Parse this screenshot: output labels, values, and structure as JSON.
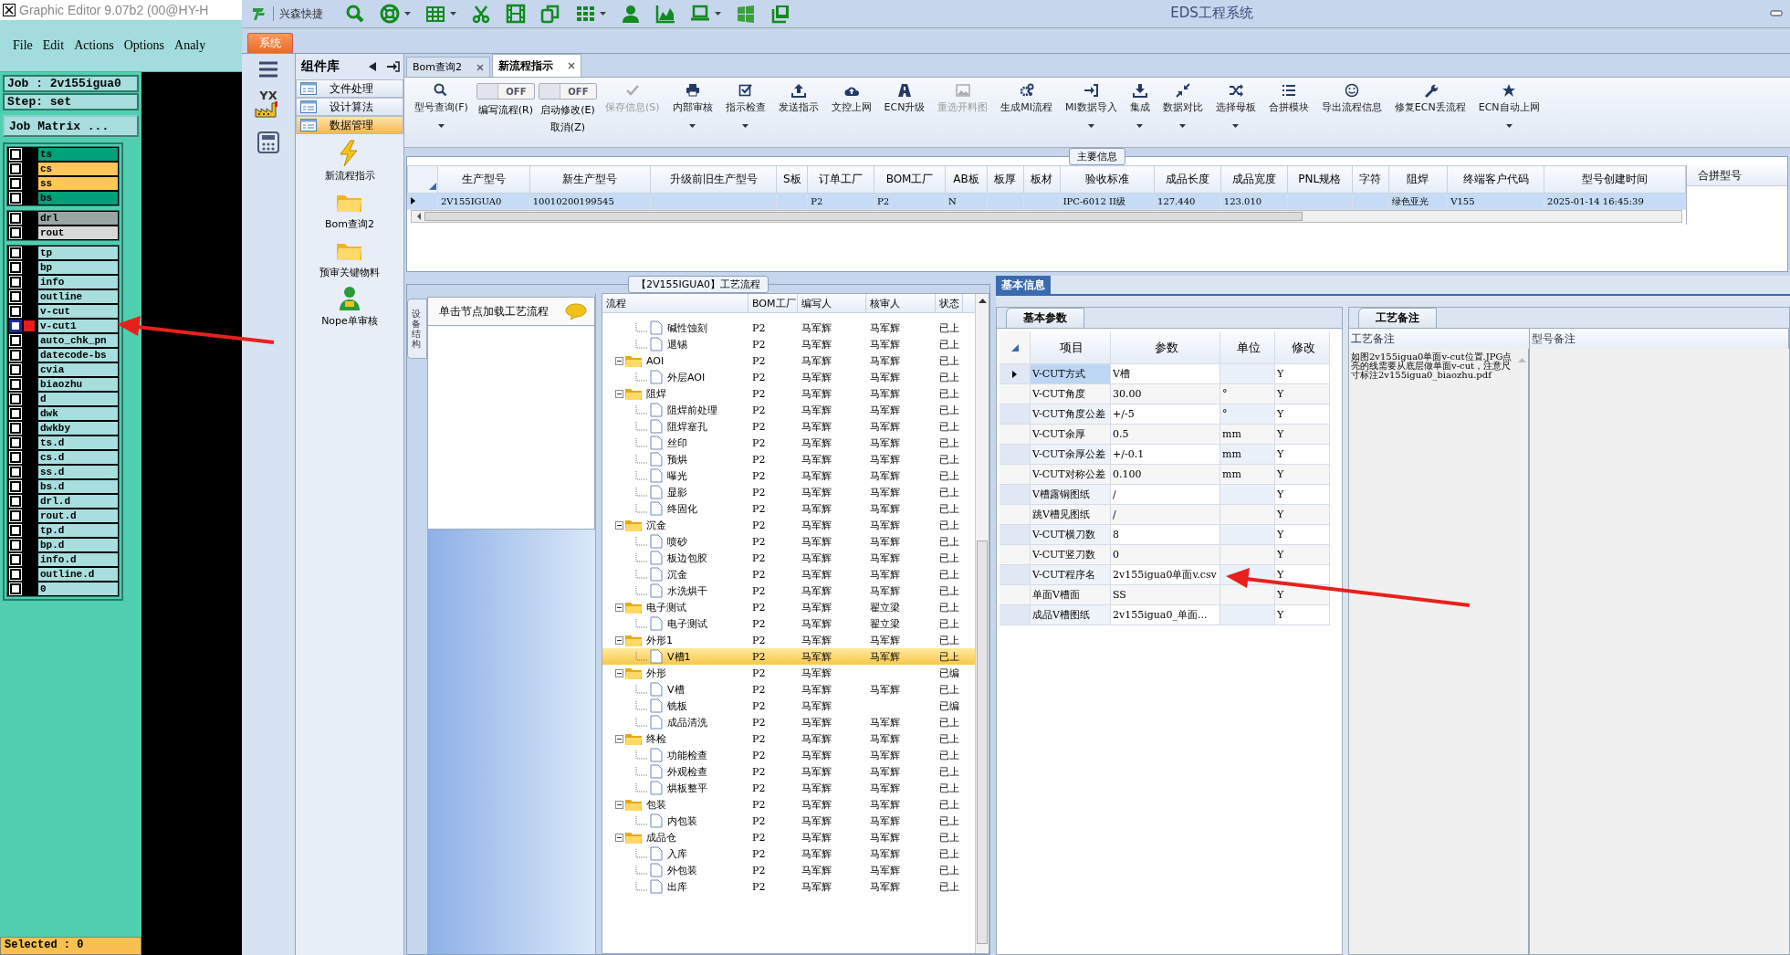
{
  "graphic_editor": {
    "title": "Graphic Editor 9.07b2 (00@HY-H",
    "menu": [
      "File",
      "Edit",
      "Actions",
      "Options",
      "Analy"
    ],
    "job": "Job : 2v155igua0",
    "step": "Step: set",
    "job_matrix_button": "Job Matrix ...",
    "layer_groups": [
      {
        "layers": [
          {
            "name": "ts",
            "color": "#00a078",
            "work_layer": false,
            "checked": false
          },
          {
            "name": "cs",
            "color": "#ffc65a",
            "work_layer": false,
            "checked": false
          },
          {
            "name": "ss",
            "color": "#ffc65a",
            "work_layer": false,
            "checked": false
          },
          {
            "name": "bs",
            "color": "#00a078",
            "work_layer": false,
            "checked": false
          }
        ]
      },
      {
        "layers": [
          {
            "name": "drl",
            "color": "#9aa6a6",
            "work_layer": false,
            "checked": false
          },
          {
            "name": "rout",
            "color": "#d8d8d8",
            "work_layer": false,
            "checked": false
          }
        ]
      },
      {
        "layers": [
          {
            "name": "tp",
            "color": "#a8dede",
            "work_layer": false,
            "checked": false
          },
          {
            "name": "bp",
            "color": "#a8dede",
            "work_layer": false,
            "checked": false
          },
          {
            "name": "info",
            "color": "#a8dede",
            "work_layer": false,
            "checked": false
          },
          {
            "name": "outline",
            "color": "#a8dede",
            "work_layer": false,
            "checked": false
          },
          {
            "name": "v-cut",
            "color": "#a8dede",
            "work_layer": false,
            "checked": false
          },
          {
            "name": "v-cut1",
            "color": "#a8dede",
            "work_layer": true,
            "checked": false
          },
          {
            "name": "auto_chk_pn",
            "color": "#a8dede",
            "work_layer": false,
            "checked": false
          },
          {
            "name": "datecode-bs",
            "color": "#a8dede",
            "work_layer": false,
            "checked": false
          },
          {
            "name": "cvia",
            "color": "#a8dede",
            "work_layer": false,
            "checked": false
          },
          {
            "name": "biaozhu",
            "color": "#a8dede",
            "work_layer": false,
            "checked": false
          },
          {
            "name": "d",
            "color": "#a8dede",
            "work_layer": false,
            "checked": false
          },
          {
            "name": "dwk",
            "color": "#a8dede",
            "work_layer": false,
            "checked": false
          },
          {
            "name": "dwkby",
            "color": "#a8dede",
            "work_layer": false,
            "checked": false
          },
          {
            "name": "ts.d",
            "color": "#a8dede",
            "work_layer": false,
            "checked": false
          },
          {
            "name": "cs.d",
            "color": "#a8dede",
            "work_layer": false,
            "checked": false
          },
          {
            "name": "ss.d",
            "color": "#a8dede",
            "work_layer": false,
            "checked": false
          },
          {
            "name": "bs.d",
            "color": "#a8dede",
            "work_layer": false,
            "checked": false
          },
          {
            "name": "drl.d",
            "color": "#a8dede",
            "work_layer": false,
            "checked": false
          },
          {
            "name": "rout.d",
            "color": "#a8dede",
            "work_layer": false,
            "checked": false
          },
          {
            "name": "tp.d",
            "color": "#a8dede",
            "work_layer": false,
            "checked": false
          },
          {
            "name": "bp.d",
            "color": "#a8dede",
            "work_layer": false,
            "checked": false
          },
          {
            "name": "info.d",
            "color": "#a8dede",
            "work_layer": false,
            "checked": false
          },
          {
            "name": "outline.d",
            "color": "#a8dede",
            "work_layer": false,
            "checked": false
          },
          {
            "name": "0",
            "color": "#a8dede",
            "work_layer": false,
            "checked": false
          }
        ]
      }
    ],
    "selected_status": "Selected : 0"
  },
  "eds": {
    "app_name": "兴森快捷",
    "title": "EDS工程系统",
    "menu_tab": "系统",
    "nav_logo": "YX",
    "component_library": {
      "title": "组件库",
      "categories": [
        {
          "label": "文件处理",
          "selected": false
        },
        {
          "label": "设计算法",
          "selected": false
        },
        {
          "label": "数据管理",
          "selected": true
        }
      ],
      "items": [
        "新流程指示",
        "Bom查询2",
        "预审关键物料",
        "Nope单审核"
      ]
    },
    "document_tabs": [
      {
        "label": "Bom查询2",
        "selected": false
      },
      {
        "label": "新流程指示",
        "selected": true
      }
    ],
    "toolbar": [
      {
        "kind": "button",
        "label": "型号查询(F)",
        "dropdown": true,
        "disabled": false
      },
      {
        "kind": "toggle",
        "state_text": "OFF",
        "on": false,
        "label": "编写流程(R)"
      },
      {
        "kind": "toggle",
        "state_text": "OFF",
        "on": false,
        "label": "启动修改(E)",
        "second_label": "取消(Z)"
      },
      {
        "kind": "button",
        "label": "保存信息(S)",
        "dropdown": false,
        "disabled": true
      },
      {
        "kind": "button",
        "label": "内部审核",
        "dropdown": true,
        "disabled": false
      },
      {
        "kind": "button",
        "label": "指示检查",
        "dropdown": true,
        "disabled": false
      },
      {
        "kind": "button",
        "label": "发送指示",
        "dropdown": false,
        "disabled": false
      },
      {
        "kind": "button",
        "label": "文控上网",
        "dropdown": false,
        "disabled": false
      },
      {
        "kind": "button",
        "label": "ECN升级",
        "dropdown": false,
        "disabled": false
      },
      {
        "kind": "button",
        "label": "重选开料图",
        "dropdown": false,
        "disabled": true
      },
      {
        "kind": "button",
        "label": "生成MI流程",
        "dropdown": false,
        "disabled": false
      },
      {
        "kind": "button",
        "label": "MI数据导入",
        "dropdown": true,
        "disabled": false
      },
      {
        "kind": "button",
        "label": "集成",
        "dropdown": true,
        "disabled": false
      },
      {
        "kind": "button",
        "label": "数据对比",
        "dropdown": true,
        "disabled": false
      },
      {
        "kind": "button",
        "label": "选择母板",
        "dropdown": true,
        "disabled": false
      },
      {
        "kind": "button",
        "label": "合拼模块",
        "dropdown": false,
        "disabled": false
      },
      {
        "kind": "button",
        "label": "导出流程信息",
        "dropdown": false,
        "disabled": false
      },
      {
        "kind": "button",
        "label": "修复ECN丢流程",
        "dropdown": false,
        "disabled": false
      },
      {
        "kind": "button",
        "label": "ECN自动上网",
        "dropdown": true,
        "disabled": false
      }
    ],
    "main_info": {
      "title": "主要信息",
      "columns": [
        "生产型号",
        "新生产型号",
        "升级前旧生产型号",
        "S板",
        "订单工厂",
        "BOM工厂",
        "AB板",
        "板厚",
        "板材",
        "验收标准",
        "成品长度",
        "成品宽度",
        "PNL规格",
        "字符",
        "阻焊",
        "终端客户代码",
        "型号创建时间"
      ],
      "rows": [
        {
          "selected": true,
          "cells": [
            "2V155IGUA0",
            "10010200199545",
            null,
            null,
            "P2",
            "P2",
            "N",
            null,
            null,
            "IPC-6012 II级",
            "127.440",
            "123.010",
            null,
            null,
            "绿色亚光",
            "V155",
            "2025-01-14 16:45:39"
          ]
        }
      ],
      "side_column": "合拼型号"
    },
    "process_flow": {
      "title": "【2V155IGUA0】工艺流程",
      "side_tab": "设备结构",
      "hint": "单击节点加载工艺流程",
      "columns": [
        "流程",
        "BOM工厂",
        "编写人",
        "核审人",
        "状态"
      ],
      "nodes": [
        {
          "kind": "offscreen",
          "children": [
            {
              "kind": "step",
              "label": "碱性蚀刻",
              "bom": "P2",
              "writer": "马军辉",
              "reviewer": "马军辉",
              "status": "已上",
              "selected": false
            },
            {
              "kind": "step",
              "label": "退锡",
              "bom": "P2",
              "writer": "马军辉",
              "reviewer": "马军辉",
              "status": "已上",
              "selected": false
            }
          ]
        },
        {
          "kind": "folder",
          "label": "AOI",
          "expanded": true,
          "bom": "P2",
          "writer": "马军辉",
          "reviewer": "马军辉",
          "status": "已上",
          "selected": false,
          "children": [
            {
              "kind": "step",
              "label": "外层AOI",
              "bom": "P2",
              "writer": "马军辉",
              "reviewer": "马军辉",
              "status": "已上",
              "selected": false
            }
          ]
        },
        {
          "kind": "folder",
          "label": "阻焊",
          "expanded": true,
          "bom": "P2",
          "writer": "马军辉",
          "reviewer": "马军辉",
          "status": "已上",
          "selected": false,
          "children": [
            {
              "kind": "step",
              "label": "阻焊前处理",
              "bom": "P2",
              "writer": "马军辉",
              "reviewer": "马军辉",
              "status": "已上",
              "selected": false
            },
            {
              "kind": "step",
              "label": "阻焊塞孔",
              "bom": "P2",
              "writer": "马军辉",
              "reviewer": "马军辉",
              "status": "已上",
              "selected": false
            },
            {
              "kind": "step",
              "label": "丝印",
              "bom": "P2",
              "writer": "马军辉",
              "reviewer": "马军辉",
              "status": "已上",
              "selected": false
            },
            {
              "kind": "step",
              "label": "预烘",
              "bom": "P2",
              "writer": "马军辉",
              "reviewer": "马军辉",
              "status": "已上",
              "selected": false
            },
            {
              "kind": "step",
              "label": "曝光",
              "bom": "P2",
              "writer": "马军辉",
              "reviewer": "马军辉",
              "status": "已上",
              "selected": false
            },
            {
              "kind": "step",
              "label": "显影",
              "bom": "P2",
              "writer": "马军辉",
              "reviewer": "马军辉",
              "status": "已上",
              "selected": false
            },
            {
              "kind": "step",
              "label": "终固化",
              "bom": "P2",
              "writer": "马军辉",
              "reviewer": "马军辉",
              "status": "已上",
              "selected": false
            }
          ]
        },
        {
          "kind": "folder",
          "label": "沉金",
          "expanded": true,
          "bom": "P2",
          "writer": "马军辉",
          "reviewer": "马军辉",
          "status": "已上",
          "selected": false,
          "children": [
            {
              "kind": "step",
              "label": "喷砂",
              "bom": "P2",
              "writer": "马军辉",
              "reviewer": "马军辉",
              "status": "已上",
              "selected": false
            },
            {
              "kind": "step",
              "label": "板边包胶",
              "bom": "P2",
              "writer": "马军辉",
              "reviewer": "马军辉",
              "status": "已上",
              "selected": false
            },
            {
              "kind": "step",
              "label": "沉金",
              "bom": "P2",
              "writer": "马军辉",
              "reviewer": "马军辉",
              "status": "已上",
              "selected": false
            },
            {
              "kind": "step",
              "label": "水洗烘干",
              "bom": "P2",
              "writer": "马军辉",
              "reviewer": "马军辉",
              "status": "已上",
              "selected": false
            }
          ]
        },
        {
          "kind": "folder",
          "label": "电子测试",
          "expanded": true,
          "bom": "P2",
          "writer": "马军辉",
          "reviewer": "翟立梁",
          "status": "已上",
          "selected": false,
          "children": [
            {
              "kind": "step",
              "label": "电子测试",
              "bom": "P2",
              "writer": "马军辉",
              "reviewer": "翟立梁",
              "status": "已上",
              "selected": false
            }
          ]
        },
        {
          "kind": "folder",
          "label": "外形1",
          "expanded": true,
          "bom": "P2",
          "writer": "马军辉",
          "reviewer": "马军辉",
          "status": "已上",
          "selected": false,
          "children": [
            {
              "kind": "step",
              "label": "V槽1",
              "bom": "P2",
              "writer": "马军辉",
              "reviewer": "马军辉",
              "status": "已上",
              "selected": true
            }
          ]
        },
        {
          "kind": "folder",
          "label": "外形",
          "expanded": true,
          "bom": "P2",
          "writer": "马军辉",
          "status": "已编",
          "selected": false,
          "children": [
            {
              "kind": "step",
              "label": "V槽",
              "bom": "P2",
              "writer": "马军辉",
              "reviewer": "马军辉",
              "status": "已上",
              "selected": false
            },
            {
              "kind": "step",
              "label": "铣板",
              "bom": "P2",
              "writer": "马军辉",
              "status": "已编",
              "selected": false
            },
            {
              "kind": "step",
              "label": "成品清洗",
              "bom": "P2",
              "writer": "马军辉",
              "reviewer": "马军辉",
              "status": "已上",
              "selected": false
            }
          ]
        },
        {
          "kind": "folder",
          "label": "终检",
          "expanded": true,
          "bom": "P2",
          "writer": "马军辉",
          "reviewer": "马军辉",
          "status": "已上",
          "selected": false,
          "children": [
            {
              "kind": "step",
              "label": "功能检查",
              "bom": "P2",
              "writer": "马军辉",
              "reviewer": "马军辉",
              "status": "已上",
              "selected": false
            },
            {
              "kind": "step",
              "label": "外观检查",
              "bom": "P2",
              "writer": "马军辉",
              "reviewer": "马军辉",
              "status": "已上",
              "selected": false
            },
            {
              "kind": "step",
              "label": "烘板整平",
              "bom": "P2",
              "writer": "马军辉",
              "reviewer": "马军辉",
              "status": "已上",
              "selected": false
            }
          ]
        },
        {
          "kind": "folder",
          "label": "包装",
          "expanded": true,
          "bom": "P2",
          "writer": "马军辉",
          "reviewer": "马军辉",
          "status": "已上",
          "selected": false,
          "children": [
            {
              "kind": "step",
              "label": "内包装",
              "bom": "P2",
              "writer": "马军辉",
              "reviewer": "马军辉",
              "status": "已上",
              "selected": false
            }
          ]
        },
        {
          "kind": "folder",
          "label": "成品仓",
          "expanded": true,
          "bom": "P2",
          "writer": "马军辉",
          "reviewer": "马军辉",
          "status": "已上",
          "selected": false,
          "children": [
            {
              "kind": "step",
              "label": "入库",
              "bom": "P2",
              "writer": "马军辉",
              "reviewer": "马军辉",
              "status": "已上",
              "selected": false
            },
            {
              "kind": "step",
              "label": "外包装",
              "bom": "P2",
              "writer": "马军辉",
              "reviewer": "马军辉",
              "status": "已上",
              "selected": false
            },
            {
              "kind": "step",
              "label": "出库",
              "bom": "P2",
              "writer": "马军辉",
              "reviewer": "马军辉",
              "status": "已上",
              "selected": false
            }
          ]
        }
      ]
    },
    "basic_info": {
      "title": "基本信息",
      "params_tab": "基本参数",
      "columns": [
        "项目",
        "参数",
        "单位",
        "修改"
      ],
      "rows": [
        {
          "item": "V-CUT方式",
          "value": "V槽",
          "modify": "Y",
          "selected": true
        },
        {
          "item": "V-CUT角度",
          "value": "30.00",
          "unit": "°",
          "modify": "Y",
          "selected": false
        },
        {
          "item": "V-CUT角度公差",
          "value": "+/-5",
          "unit": "°",
          "modify": "Y",
          "selected": false
        },
        {
          "item": "V-CUT余厚",
          "value": "0.5",
          "unit": "mm",
          "modify": "Y",
          "selected": false
        },
        {
          "item": "V-CUT余厚公差",
          "value": "+/-0.1",
          "unit": "mm",
          "modify": "Y",
          "selected": false
        },
        {
          "item": "V-CUT对称公差",
          "value": "0.100",
          "unit": "mm",
          "modify": "Y",
          "selected": false
        },
        {
          "item": "V槽露铜图纸",
          "value": "/",
          "modify": "Y",
          "selected": false
        },
        {
          "item": "跳V槽见图纸",
          "value": "/",
          "modify": "Y",
          "selected": false
        },
        {
          "item": "V-CUT横刀数",
          "value": "8",
          "modify": "Y",
          "selected": false
        },
        {
          "item": "V-CUT竖刀数",
          "value": "0",
          "modify": "Y",
          "selected": false
        },
        {
          "item": "V-CUT程序名",
          "value": "2v155igua0单面v.csv",
          "modify": "Y",
          "selected": false
        },
        {
          "item": "单面V槽面",
          "value": "SS",
          "modify": "Y",
          "selected": false
        },
        {
          "item": "成品V槽图纸",
          "value": "2v155igua0_单面...",
          "modify": "Y",
          "selected": false
        }
      ]
    },
    "notes": {
      "tab": "工艺备注",
      "columns": [
        "工艺备注",
        "型号备注"
      ],
      "process_note": "如图2v155igua0单面v-cut位置.JPG点亮的线需要从底层做单面v-cut，注意尺寸标注2v155igua0_biaozhu.pdf"
    }
  }
}
